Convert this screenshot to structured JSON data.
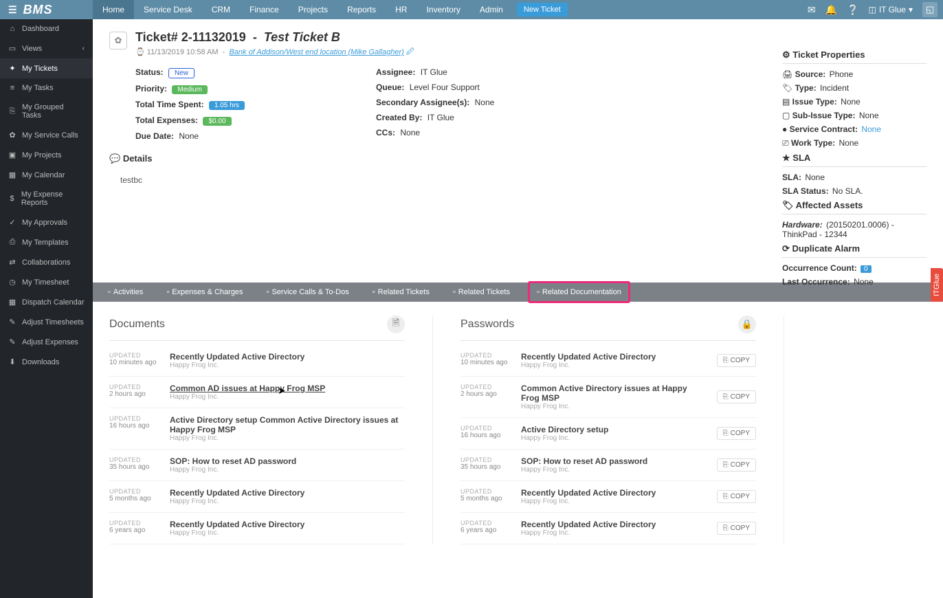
{
  "brand": "BMS",
  "topnav": [
    "Home",
    "Service Desk",
    "CRM",
    "Finance",
    "Projects",
    "Reports",
    "HR",
    "Inventory",
    "Admin"
  ],
  "topnav_active": "Home",
  "new_ticket_label": "New Ticket",
  "user_label": "IT Glue",
  "sidebar": [
    {
      "icon": "⌂",
      "label": "Dashboard"
    },
    {
      "icon": "▭",
      "label": "Views",
      "chev": true
    },
    {
      "icon": "✦",
      "label": "My Tickets",
      "active": true
    },
    {
      "icon": "≡",
      "label": "My Tasks"
    },
    {
      "icon": "⎘",
      "label": "My Grouped Tasks"
    },
    {
      "icon": "✿",
      "label": "My Service Calls"
    },
    {
      "icon": "▣",
      "label": "My Projects"
    },
    {
      "icon": "▦",
      "label": "My Calendar"
    },
    {
      "icon": "$",
      "label": "My Expense Reports"
    },
    {
      "icon": "✓",
      "label": "My Approvals"
    },
    {
      "icon": "⎙",
      "label": "My Templates"
    },
    {
      "icon": "⇄",
      "label": "Collaborations"
    },
    {
      "icon": "◷",
      "label": "My Timesheet"
    },
    {
      "icon": "▦",
      "label": "Dispatch Calendar"
    },
    {
      "icon": "✎",
      "label": "Adjust Timesheets"
    },
    {
      "icon": "✎",
      "label": "Adjust Expenses"
    },
    {
      "icon": "⬇",
      "label": "Downloads"
    }
  ],
  "ticket": {
    "number": "Ticket# 2-11132019",
    "title": "Test Ticket B",
    "datetime": "11/13/2019 10:58 AM",
    "location_link": "Bank of Addison/West end location (Mike Gallagher)",
    "status_label": "Status:",
    "status": "New",
    "priority_label": "Priority:",
    "priority": "Medium",
    "time_label": "Total Time Spent:",
    "time": "1.05 hrs",
    "expense_label": "Total Expenses:",
    "expense": "$0.00",
    "due_label": "Due Date:",
    "due": "None",
    "assignee_label": "Assignee:",
    "assignee": "IT Glue",
    "queue_label": "Queue:",
    "queue": "Level Four Support",
    "secondary_label": "Secondary Assignee(s):",
    "secondary": "None",
    "createdby_label": "Created By:",
    "createdby": "IT Glue",
    "ccs_label": "CCs:",
    "ccs": "None",
    "details_heading": "Details",
    "details_body": "testbc"
  },
  "props": {
    "heading": "Ticket Properties",
    "source_l": "Source:",
    "source": "Phone",
    "type_l": "Type:",
    "type": "Incident",
    "issue_l": "Issue Type:",
    "issue": "None",
    "subissue_l": "Sub-Issue Type:",
    "subissue": "None",
    "contract_l": "Service Contract:",
    "contract": "None",
    "work_l": "Work Type:",
    "work": "None",
    "sla_heading": "SLA",
    "sla_l": "SLA:",
    "sla": "None",
    "slastatus_l": "SLA Status:",
    "slastatus": "No SLA.",
    "assets_heading": "Affected Assets",
    "hardware_l": "Hardware:",
    "hardware": "(20150201.0006) - ThinkPad - 12344",
    "dup_heading": "Duplicate Alarm",
    "occ_l": "Occurrence Count:",
    "occ": "0",
    "last_l": "Last Occurrence:",
    "last": "None"
  },
  "tabs": [
    {
      "label": "Activities"
    },
    {
      "label": "Expenses & Charges"
    },
    {
      "label": "Service Calls & To-Dos"
    },
    {
      "label": "Related Tickets"
    },
    {
      "label": "Related Tickets"
    },
    {
      "label": "Related Documentation",
      "hl": true
    }
  ],
  "docs_heading": "Documents",
  "pwd_heading": "Passwords",
  "updated_label": "UPDATED",
  "copy_label": "COPY",
  "documents": [
    {
      "time": "10 minutes ago",
      "title": "Recently Updated Active Directory",
      "org": "Happy Frog Inc."
    },
    {
      "time": "2 hours ago",
      "title": "Common AD issues at Happy Frog MSP",
      "org": "Happy Frog Inc.",
      "ul": true
    },
    {
      "time": "16 hours ago",
      "title": "Active Directory setup Common Active Directory issues at Happy Frog MSP",
      "org": "Happy Frog Inc."
    },
    {
      "time": "35 hours ago",
      "title": "SOP: How to reset AD password",
      "org": "Happy Frog Inc."
    },
    {
      "time": "5 months ago",
      "title": "Recently Updated Active Directory",
      "org": "Happy Frog Inc."
    },
    {
      "time": "6 years ago",
      "title": "Recently Updated Active Directory",
      "org": "Happy Frog Inc."
    }
  ],
  "passwords": [
    {
      "time": "10 minutes ago",
      "title": "Recently Updated Active Directory",
      "org": "Happy Frog Inc."
    },
    {
      "time": "2 hours ago",
      "title": "Common Active Directory issues at Happy Frog MSP",
      "org": "Happy Frog Inc."
    },
    {
      "time": "16 hours ago",
      "title": "Active Directory setup",
      "org": "Happy Frog Inc."
    },
    {
      "time": "35 hours ago",
      "title": "SOP: How to reset AD password",
      "org": "Happy Frog Inc."
    },
    {
      "time": "5 months ago",
      "title": "Recently Updated Active Directory",
      "org": "Happy Frog Inc."
    },
    {
      "time": "6 years ago",
      "title": "Recently Updated Active Directory",
      "org": "Happy Frog Inc."
    }
  ],
  "vtab": "ITGlue"
}
